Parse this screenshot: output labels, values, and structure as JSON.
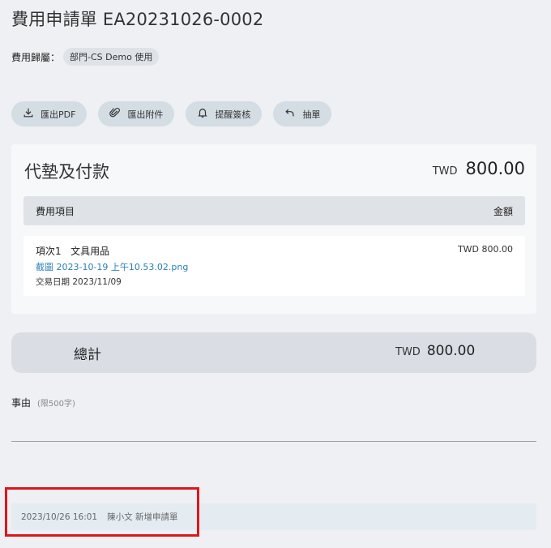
{
  "header": {
    "title": "費用申請單 EA20231026-0002",
    "attribution_label": "費用歸屬：",
    "attribution_value": "部門-CS Demo 使用"
  },
  "actions": [
    {
      "label": "匯出PDF",
      "icon": "download-icon"
    },
    {
      "label": "匯出附件",
      "icon": "paperclip-icon"
    },
    {
      "label": "提醒簽核",
      "icon": "bell-icon"
    },
    {
      "label": "抽單",
      "icon": "undo-arrow-icon"
    }
  ],
  "card": {
    "title": "代墊及付款",
    "currency": "TWD",
    "amount": "800.00",
    "columns": {
      "item": "費用項目",
      "amount": "金額"
    },
    "rows": [
      {
        "item": "項次1   文具用品",
        "amount": "TWD 800.00",
        "attachment": "截圖 2023-10-19 上午10.53.02.png",
        "date": "交易日期 2023/11/09"
      }
    ]
  },
  "total": {
    "label": "總計",
    "currency": "TWD",
    "amount": "800.00"
  },
  "reason": {
    "label": "事由",
    "hint": "(限500字)",
    "value": ""
  },
  "log": {
    "timestamp": "2023/10/26 16:01",
    "text": "陳小文 新增申請單"
  },
  "colors": {
    "background": "#eef0f4",
    "button": "#d4dce4",
    "link": "#2a80b9",
    "highlight": "#e0161b"
  }
}
